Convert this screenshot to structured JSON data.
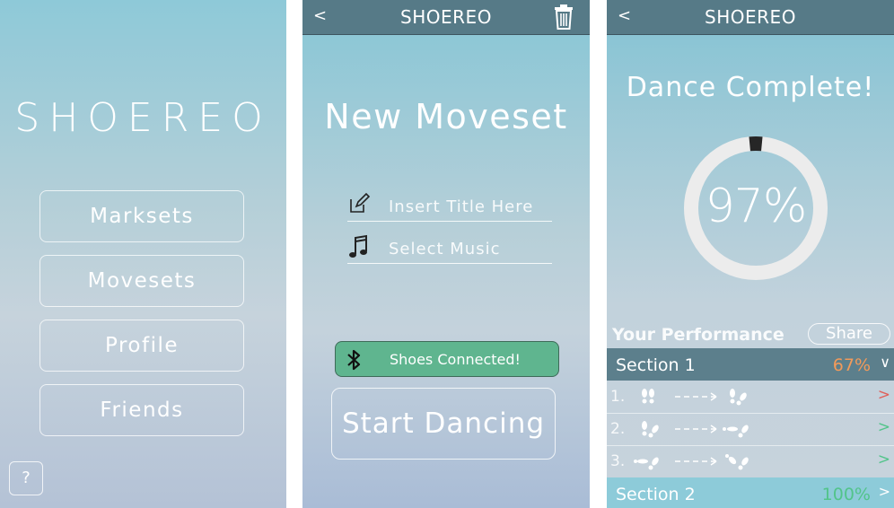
{
  "screen_home": {
    "logo": "SHOEREO",
    "menu": [
      "Marksets",
      "Movesets",
      "Profile",
      "Friends"
    ],
    "help_label": "?"
  },
  "screen_new_moveset": {
    "back_label": "<",
    "title": "SHOEREO",
    "heading": "New Moveset",
    "title_placeholder": "Insert Title Here",
    "music_placeholder": "Select Music",
    "status_text": "Shoes Connected!",
    "start_label": "Start Dancing",
    "icons": [
      "trash-icon",
      "edit-icon",
      "music-note-icon",
      "bluetooth-icon"
    ],
    "colors": {
      "topbar": "#567a87",
      "connected": "#5fb58f"
    }
  },
  "screen_results": {
    "back_label": "<",
    "title": "SHOEREO",
    "heading": "Dance Complete!",
    "score_text": "97%",
    "score_fraction": 0.97,
    "performance_label": "Your Performance",
    "share_label": "Share",
    "sections": [
      {
        "name": "Section 1",
        "value": "67%",
        "chevron": "∨",
        "color": "#f29a5a"
      },
      {
        "name": "Section 2",
        "value": "100%",
        "chevron": ">",
        "color": "#52c48a"
      }
    ],
    "moves": [
      {
        "num": "1.",
        "status": "wrong",
        "chevron": ">",
        "color": "#e0605a"
      },
      {
        "num": "2.",
        "status": "correct",
        "chevron": ">",
        "color": "#52c48a"
      },
      {
        "num": "3.",
        "status": "correct",
        "chevron": ">",
        "color": "#52c48a"
      }
    ],
    "icons": [
      "footprints-icon",
      "dashed-arrow-icon"
    ]
  }
}
